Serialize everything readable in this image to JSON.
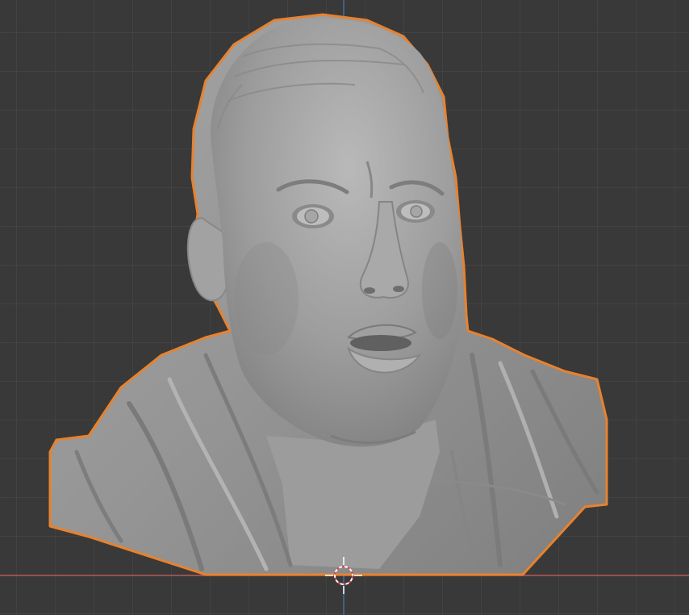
{
  "viewport": {
    "mode": "object",
    "background_color": "#393939",
    "grid_color": "#4a4a4a",
    "x_axis_color": "#c45a57",
    "z_axis_color": "#4a78b5",
    "selection_outline_color": "#e8822e",
    "mesh_color": "#9a9a9a"
  },
  "scene": {
    "object": {
      "name": "sculpted-bust",
      "selected": true,
      "shading": "solid"
    },
    "cursor_3d": {
      "visible": true
    }
  }
}
